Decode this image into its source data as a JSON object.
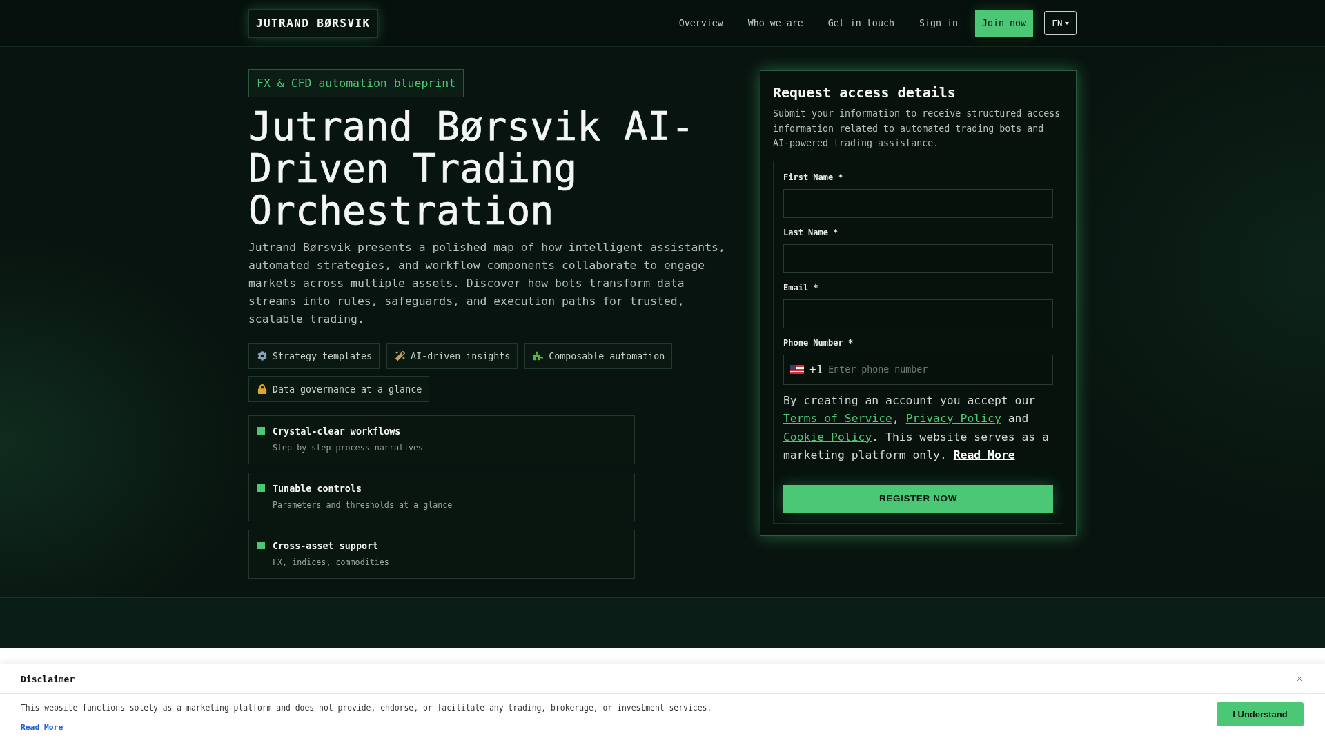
{
  "header": {
    "logo": "JUTRAND BØRSVIK",
    "nav": [
      {
        "label": "Overview"
      },
      {
        "label": "Who we are"
      },
      {
        "label": "Get in touch"
      },
      {
        "label": "Sign in"
      }
    ],
    "cta": "Join now",
    "language": "EN"
  },
  "hero": {
    "badge": "FX & CFD automation blueprint",
    "title": "Jutrand Børsvik AI-Driven Trading Orchestration",
    "description": "Jutrand Børsvik presents a polished map of how intelligent assistants, automated strategies, and workflow components collaborate to engage markets across multiple assets. Discover how bots transform data streams into rules, safeguards, and execution paths for trusted, scalable trading.",
    "tags": [
      {
        "label": "Strategy templates"
      },
      {
        "label": "AI-driven insights"
      },
      {
        "label": "Composable automation"
      },
      {
        "label": "Data governance at a glance"
      }
    ],
    "features": [
      {
        "title": "Crystal-clear workflows",
        "subtitle": "Step-by-step process narratives"
      },
      {
        "title": "Tunable controls",
        "subtitle": "Parameters and thresholds at a glance"
      },
      {
        "title": "Cross-asset support",
        "subtitle": "FX, indices, commodities"
      }
    ]
  },
  "form": {
    "title": "Request access details",
    "description": "Submit your information to receive structured access information related to automated trading bots and AI-powered trading assistance.",
    "fields": [
      {
        "kind": "text",
        "label": "First Name *"
      },
      {
        "kind": "text",
        "label": "Last Name *"
      },
      {
        "kind": "text",
        "label": "Email *"
      },
      {
        "kind": "phone",
        "label": "Phone Number *",
        "dial_code": "+1",
        "placeholder": "Enter phone number"
      }
    ],
    "consent": [
      {
        "kind": "text",
        "text": "By creating an account you accept our "
      },
      {
        "kind": "link",
        "text": "Terms of Service"
      },
      {
        "kind": "text",
        "text": ", "
      },
      {
        "kind": "link",
        "text": "Privacy Policy"
      },
      {
        "kind": "text",
        "text": " and "
      },
      {
        "kind": "link",
        "text": "Cookie Policy"
      },
      {
        "kind": "text",
        "text": ". This website serves as a marketing platform only. "
      },
      {
        "kind": "more",
        "text": "Read More"
      }
    ],
    "submit": "REGISTER NOW"
  },
  "disclaimer": {
    "title": "Disclaimer",
    "text": "This website functions solely as a marketing platform and does not provide, endorse, or facilitate any trading, brokerage, or investment services.",
    "link": "Read More",
    "button": "I Understand"
  }
}
